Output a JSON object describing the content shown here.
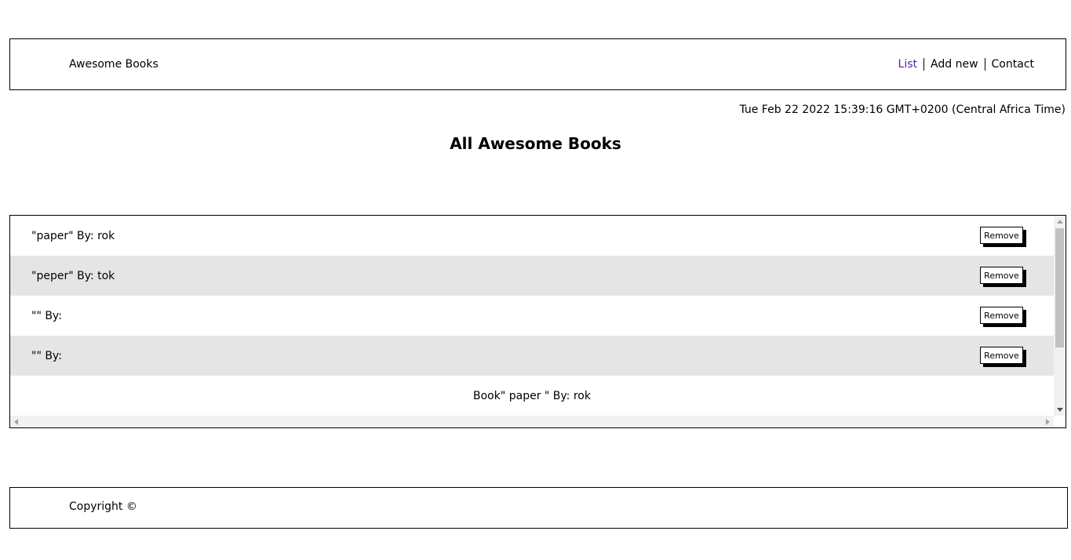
{
  "nav": {
    "brand": "Awesome Books",
    "links": [
      {
        "label": "List",
        "active": true
      },
      {
        "label": "Add new",
        "active": false
      },
      {
        "label": "Contact",
        "active": false
      }
    ],
    "active_color": "#5a1ab0"
  },
  "datetime": "Tue Feb 22 2022 15:39:16 GMT+0200 (Central Africa Time)",
  "page_title": "All Awesome Books",
  "books": [
    {
      "text": "\"paper\" By: rok",
      "remove_label": "Remove"
    },
    {
      "text": "\"peper\" By: tok",
      "remove_label": "Remove"
    },
    {
      "text": "\"\" By:",
      "remove_label": "Remove"
    },
    {
      "text": "\"\" By:",
      "remove_label": "Remove"
    }
  ],
  "preview_text": "Book\" paper \" By: rok",
  "footer": {
    "copyright": "Copyright ©"
  },
  "colors": {
    "row_alt": "#e5e5e5",
    "border": "#000000"
  }
}
